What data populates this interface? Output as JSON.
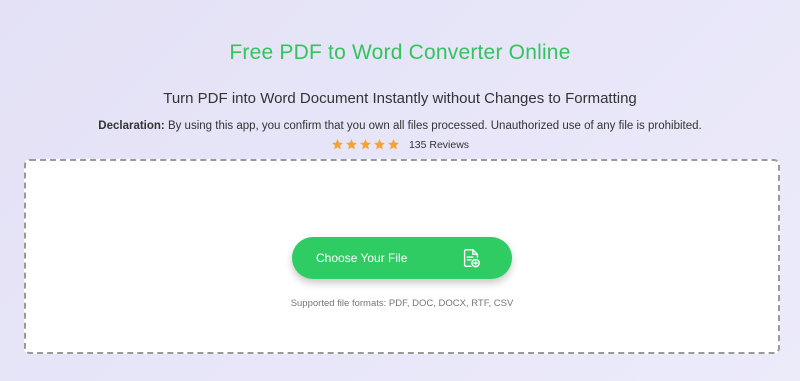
{
  "header": {
    "title": "Free PDF to Word Converter Online",
    "subtitle": "Turn PDF into Word Document Instantly without Changes to Formatting",
    "declaration_label": "Declaration:",
    "declaration_text": " By using this app, you confirm that you own all files processed. Unauthorized use of any file is prohibited."
  },
  "rating": {
    "stars": 5,
    "reviews_label": "135 Reviews",
    "star_color": "#f7a234"
  },
  "upload": {
    "button_label": "Choose Your File",
    "button_icon": "file-add-icon",
    "supported_formats": "Supported file formats: PDF, DOC, DOCX, RTF, CSV"
  },
  "colors": {
    "accent": "#2fcb63",
    "title": "#33c45e"
  }
}
